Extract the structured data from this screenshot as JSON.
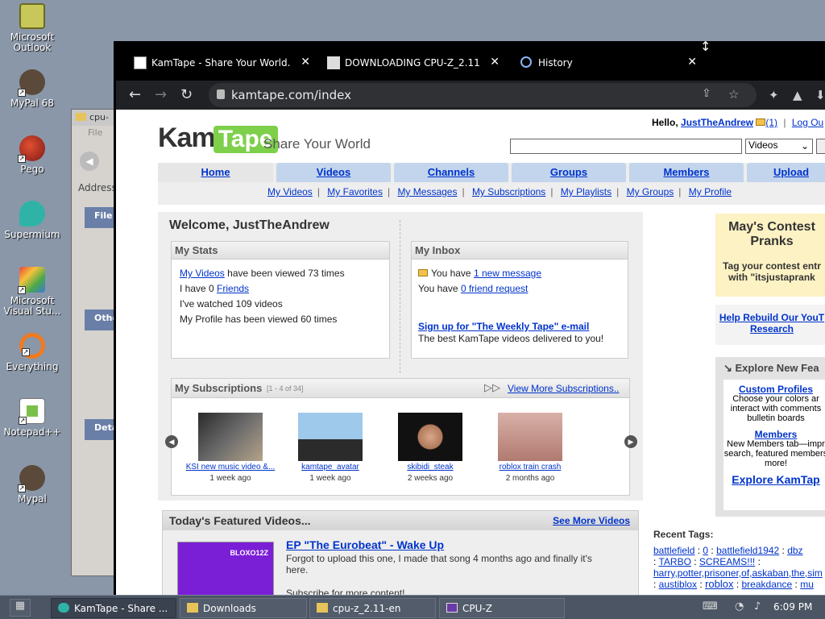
{
  "desktop": {
    "icons": [
      {
        "label": "Microsoft\nOutlook",
        "name": "microsoft-outlook-icon"
      },
      {
        "label": "MyPal 68",
        "name": "mypal68-icon"
      },
      {
        "label": "Pego",
        "name": "pego-icon"
      },
      {
        "label": "Supermium",
        "name": "supermium-icon"
      },
      {
        "label": "Microsoft\nVisual Stu...",
        "name": "visual-studio-icon"
      },
      {
        "label": "Everything",
        "name": "everything-icon"
      },
      {
        "label": "Notepad++",
        "name": "notepadpp-icon"
      },
      {
        "label": "Mypal",
        "name": "mypal-icon"
      }
    ]
  },
  "bg_window": {
    "title": "cpu-",
    "menu": "File",
    "address": "Address",
    "file_panel": "File",
    "other_panel": "Othe",
    "details_panel": "Deta"
  },
  "browser": {
    "tabs": [
      {
        "title": "KamTape - Share Your World.",
        "close": "✕"
      },
      {
        "title": "DOWNLOADING CPU-Z_2.11",
        "close": "✕"
      },
      {
        "title": "History",
        "close": "✕"
      }
    ],
    "url": "kamtape.com/index"
  },
  "kamtape": {
    "logo_kam": "Kam",
    "logo_tape": "Tape",
    "tagline": "Share Your World",
    "hello_prefix": "Hello,",
    "username": "JustTheAndrew",
    "inbox_count": "(1)",
    "logout": "Log Ou",
    "search_category": "Videos",
    "nav_tabs": [
      "Home",
      "Videos",
      "Channels",
      "Groups",
      "Members",
      "Upload"
    ],
    "sub_nav": [
      "My Videos",
      "My Favorites",
      "My Messages",
      "My Subscriptions",
      "My Playlists",
      "My Groups",
      "My Profile"
    ],
    "welcome": "Welcome, JustTheAndrew",
    "stats": {
      "title": "My Stats",
      "videos_link": "My Videos",
      "videos_text": " have been viewed 73 times",
      "friends_prefix": "I have 0 ",
      "friends_link": "Friends",
      "watched": "I've watched 109 videos",
      "profile": "My Profile has been viewed 60 times"
    },
    "inbox": {
      "title": "My Inbox",
      "msg_prefix": "You have ",
      "msg_link": "1 new message",
      "friend_prefix": "You have ",
      "friend_link": "0 friend request",
      "signup_link": "Sign up for \"The Weekly Tape\" e-mail",
      "signup_text": "The best KamTape videos delivered to you!"
    },
    "subscriptions": {
      "title": "My Subscriptions",
      "range": "[1 - 4 of 34]",
      "view_more": "View More Subscriptions..",
      "items": [
        {
          "title": "KSI new music video &...",
          "age": "1 week ago",
          "color": "#4a4f55"
        },
        {
          "title": "kamtape_avatar",
          "age": "1 week ago",
          "color": "#7eb2d8"
        },
        {
          "title": "skibidi_steak",
          "age": "2 weeks ago",
          "color": "#8a5a3c"
        },
        {
          "title": "roblox train crash",
          "age": "2 months ago",
          "color": "#c58a7a"
        }
      ]
    },
    "featured": {
      "title": "Today's Featured Videos...",
      "see_more": "See More Videos",
      "video_title": "EP \"The Eurobeat\" - Wake Up",
      "thumb_text": "BLOXO12Z",
      "desc": "Forgot to upload this one, I made that song 4 months ago and finally it's here.",
      "desc2": "Subscribe for more content!"
    },
    "contest": {
      "title": "May's Contest",
      "subtitle": "Pranks",
      "tag_line1": "Tag your contest entr",
      "tag_line2": "with \"itsjustaprank"
    },
    "help": {
      "line1": "Help Rebuild Our YouT",
      "line2": "Research"
    },
    "explore": {
      "title": "Explore New Fea",
      "custom_profiles": "Custom Profiles",
      "cp_desc1": "Choose your colors ar",
      "cp_desc2": "interact with comments",
      "cp_desc3": "bulletin boards",
      "members": "Members",
      "m_desc1": "New Members tab—impr",
      "m_desc2": "search, featured members",
      "m_desc3": "more!",
      "explore_link": "Explore KamTap"
    },
    "recent_tags": {
      "title": "Recent Tags:",
      "tags": [
        "battlefield",
        "0",
        "battlefield1942",
        "dbz",
        "TARBO",
        "SCREAMS!!!",
        "harry,potter,prisoner,of,askaban,the,sim",
        "austiblox",
        "roblox",
        "breakdance",
        "mu"
      ]
    }
  },
  "taskbar": {
    "items": [
      "KamTape - Share ...",
      "Downloads",
      "cpu-z_2.11-en",
      "CPU-Z"
    ],
    "time": "6:09 PM"
  }
}
